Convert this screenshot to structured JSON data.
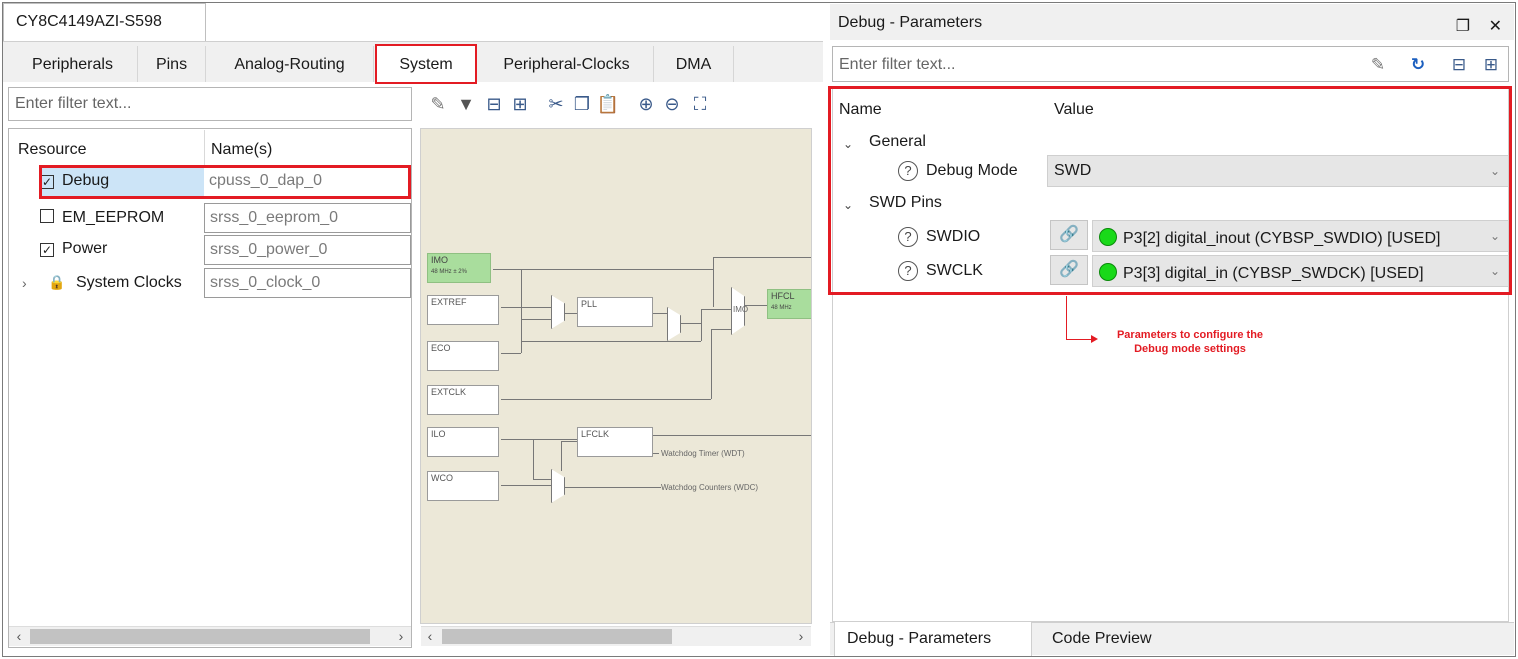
{
  "device": {
    "name": "CY8C4149AZI-S598"
  },
  "tabs": [
    {
      "label": "Peripherals"
    },
    {
      "label": "Pins"
    },
    {
      "label": "Analog-Routing"
    },
    {
      "label": "System"
    },
    {
      "label": "Peripheral-Clocks"
    },
    {
      "label": "DMA"
    }
  ],
  "left_filter": {
    "placeholder": "Enter filter text..."
  },
  "resource_table": {
    "headers": {
      "resource": "Resource",
      "names": "Name(s)"
    },
    "rows": [
      {
        "resource": "Debug",
        "name": "cpuss_0_dap_0",
        "checked": true
      },
      {
        "resource": "EM_EEPROM",
        "name": "srss_0_eeprom_0",
        "checked": false
      },
      {
        "resource": "Power",
        "name": "srss_0_power_0",
        "checked": true
      },
      {
        "resource": "System Clocks",
        "name": "srss_0_clock_0",
        "checked": true
      }
    ]
  },
  "diagram": {
    "imo": "IMO",
    "imo_sub": "48 MHz ± 2%",
    "extref": "EXTREF",
    "eco": "ECO",
    "extclk": "EXTCLK",
    "ilo": "ILO",
    "wco": "WCO",
    "pll": "PLL",
    "lfclk": "LFCLK",
    "hfclk": "HFCL",
    "hfclk_sub": "48 MHz",
    "imo_mux": "IMO",
    "wdt": "Watchdog Timer (WDT)",
    "wdc": "Watchdog Counters (WDC)"
  },
  "right_panel": {
    "title": "Debug - Parameters",
    "filter_placeholder": "Enter filter text...",
    "headers": {
      "name": "Name",
      "value": "Value"
    },
    "general": {
      "label": "General",
      "debug_mode_label": "Debug Mode",
      "debug_mode_value": "SWD"
    },
    "swd_pins": {
      "label": "SWD Pins",
      "swdio": {
        "label": "SWDIO",
        "value": "P3[2] digital_inout (CYBSP_SWDIO) [USED]"
      },
      "swclk": {
        "label": "SWCLK",
        "value": "P3[3] digital_in (CYBSP_SWDCK) [USED]"
      }
    }
  },
  "annotation": {
    "line1": "Parameters to configure the",
    "line2": "Debug mode settings"
  },
  "bottom_tabs": [
    {
      "label": "Debug - Parameters"
    },
    {
      "label": "Code Preview"
    }
  ],
  "colors": {
    "highlight": "#e31b23",
    "selection": "#cce4f7",
    "status_used": "#19d919"
  }
}
